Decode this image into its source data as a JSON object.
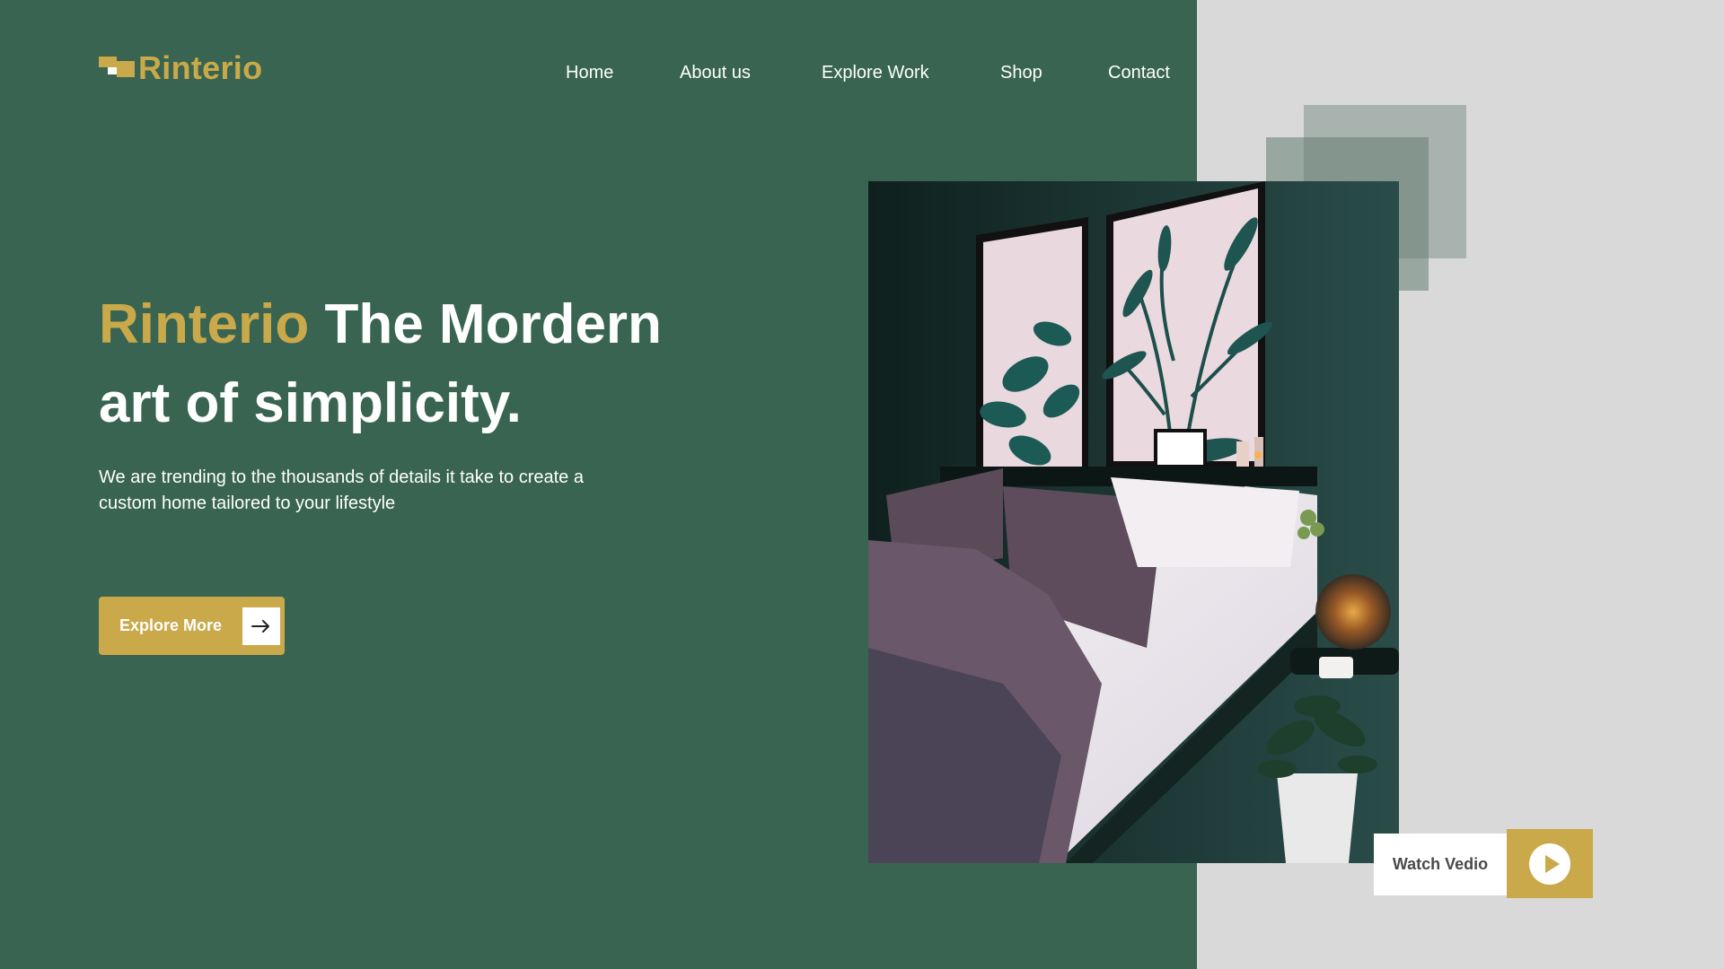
{
  "brand": {
    "name": "Rinterio",
    "icon": "logo-blocks-icon"
  },
  "nav": {
    "items": [
      "Home",
      "About us",
      "Explore Work",
      "Shop",
      "Contact"
    ]
  },
  "hero": {
    "headline_brand": "Rinterio",
    "headline_rest_line1": "The Mordern",
    "headline_line2": "art of simplicity.",
    "subtext": "We are trending to the thousands of details it take to create a custom home tailored to your lifestyle",
    "cta_label": "Explore More",
    "cta_icon": "arrow-right-icon"
  },
  "media": {
    "photo_subject": "bedroom-interior-photo",
    "watch_label": "Watch Vedio",
    "watch_icon": "play-icon"
  },
  "colors": {
    "primary_green": "#386451",
    "accent_gold": "#c9a94a",
    "light_gray": "#d9d9d9",
    "white": "#ffffff"
  }
}
